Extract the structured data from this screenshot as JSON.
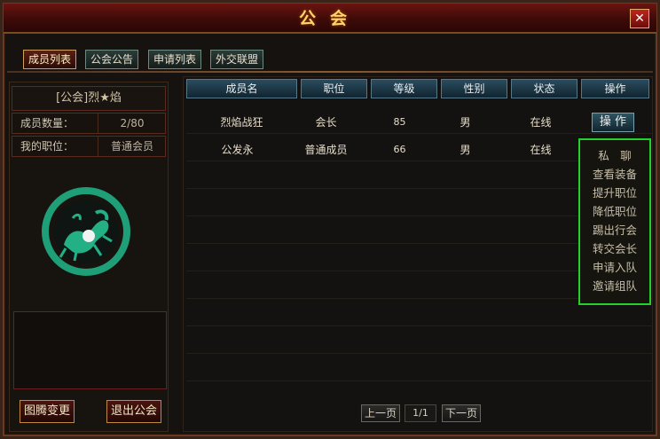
{
  "window": {
    "title": "公会",
    "close_label": "✕"
  },
  "tabs": [
    {
      "label": "成员列表",
      "active": true
    },
    {
      "label": "公会公告",
      "active": false
    },
    {
      "label": "申请列表",
      "active": false
    },
    {
      "label": "外交联盟",
      "active": false
    }
  ],
  "guild": {
    "name": "[公会]烈★焰",
    "member_count_label": "成员数量：",
    "member_count_value": "2/80",
    "my_position_label": "我的职位：",
    "my_position_value": "普通会员",
    "emblem_icon": "dragon-emblem-icon"
  },
  "buttons": {
    "totem_change": "图腾变更",
    "leave_guild": "退出公会"
  },
  "table": {
    "headers": [
      "成员名",
      "职位",
      "等级",
      "性别",
      "状态",
      "操作"
    ],
    "rows": [
      {
        "name": "烈焰战狂",
        "position": "会长",
        "level": "85",
        "gender": "男",
        "status": "在线",
        "action": "操 作"
      },
      {
        "name": "公发永",
        "position": "普通成员",
        "level": "66",
        "gender": "男",
        "status": "在线"
      }
    ]
  },
  "context_menu": {
    "items": [
      "私　聊",
      "查看装备",
      "提升职位",
      "降低职位",
      "踢出行会",
      "转交会长",
      "申请入队",
      "邀请组队"
    ],
    "highlight_color": "#23d12a"
  },
  "pager": {
    "prev": "上一页",
    "page": "1/1",
    "next": "下一页"
  }
}
